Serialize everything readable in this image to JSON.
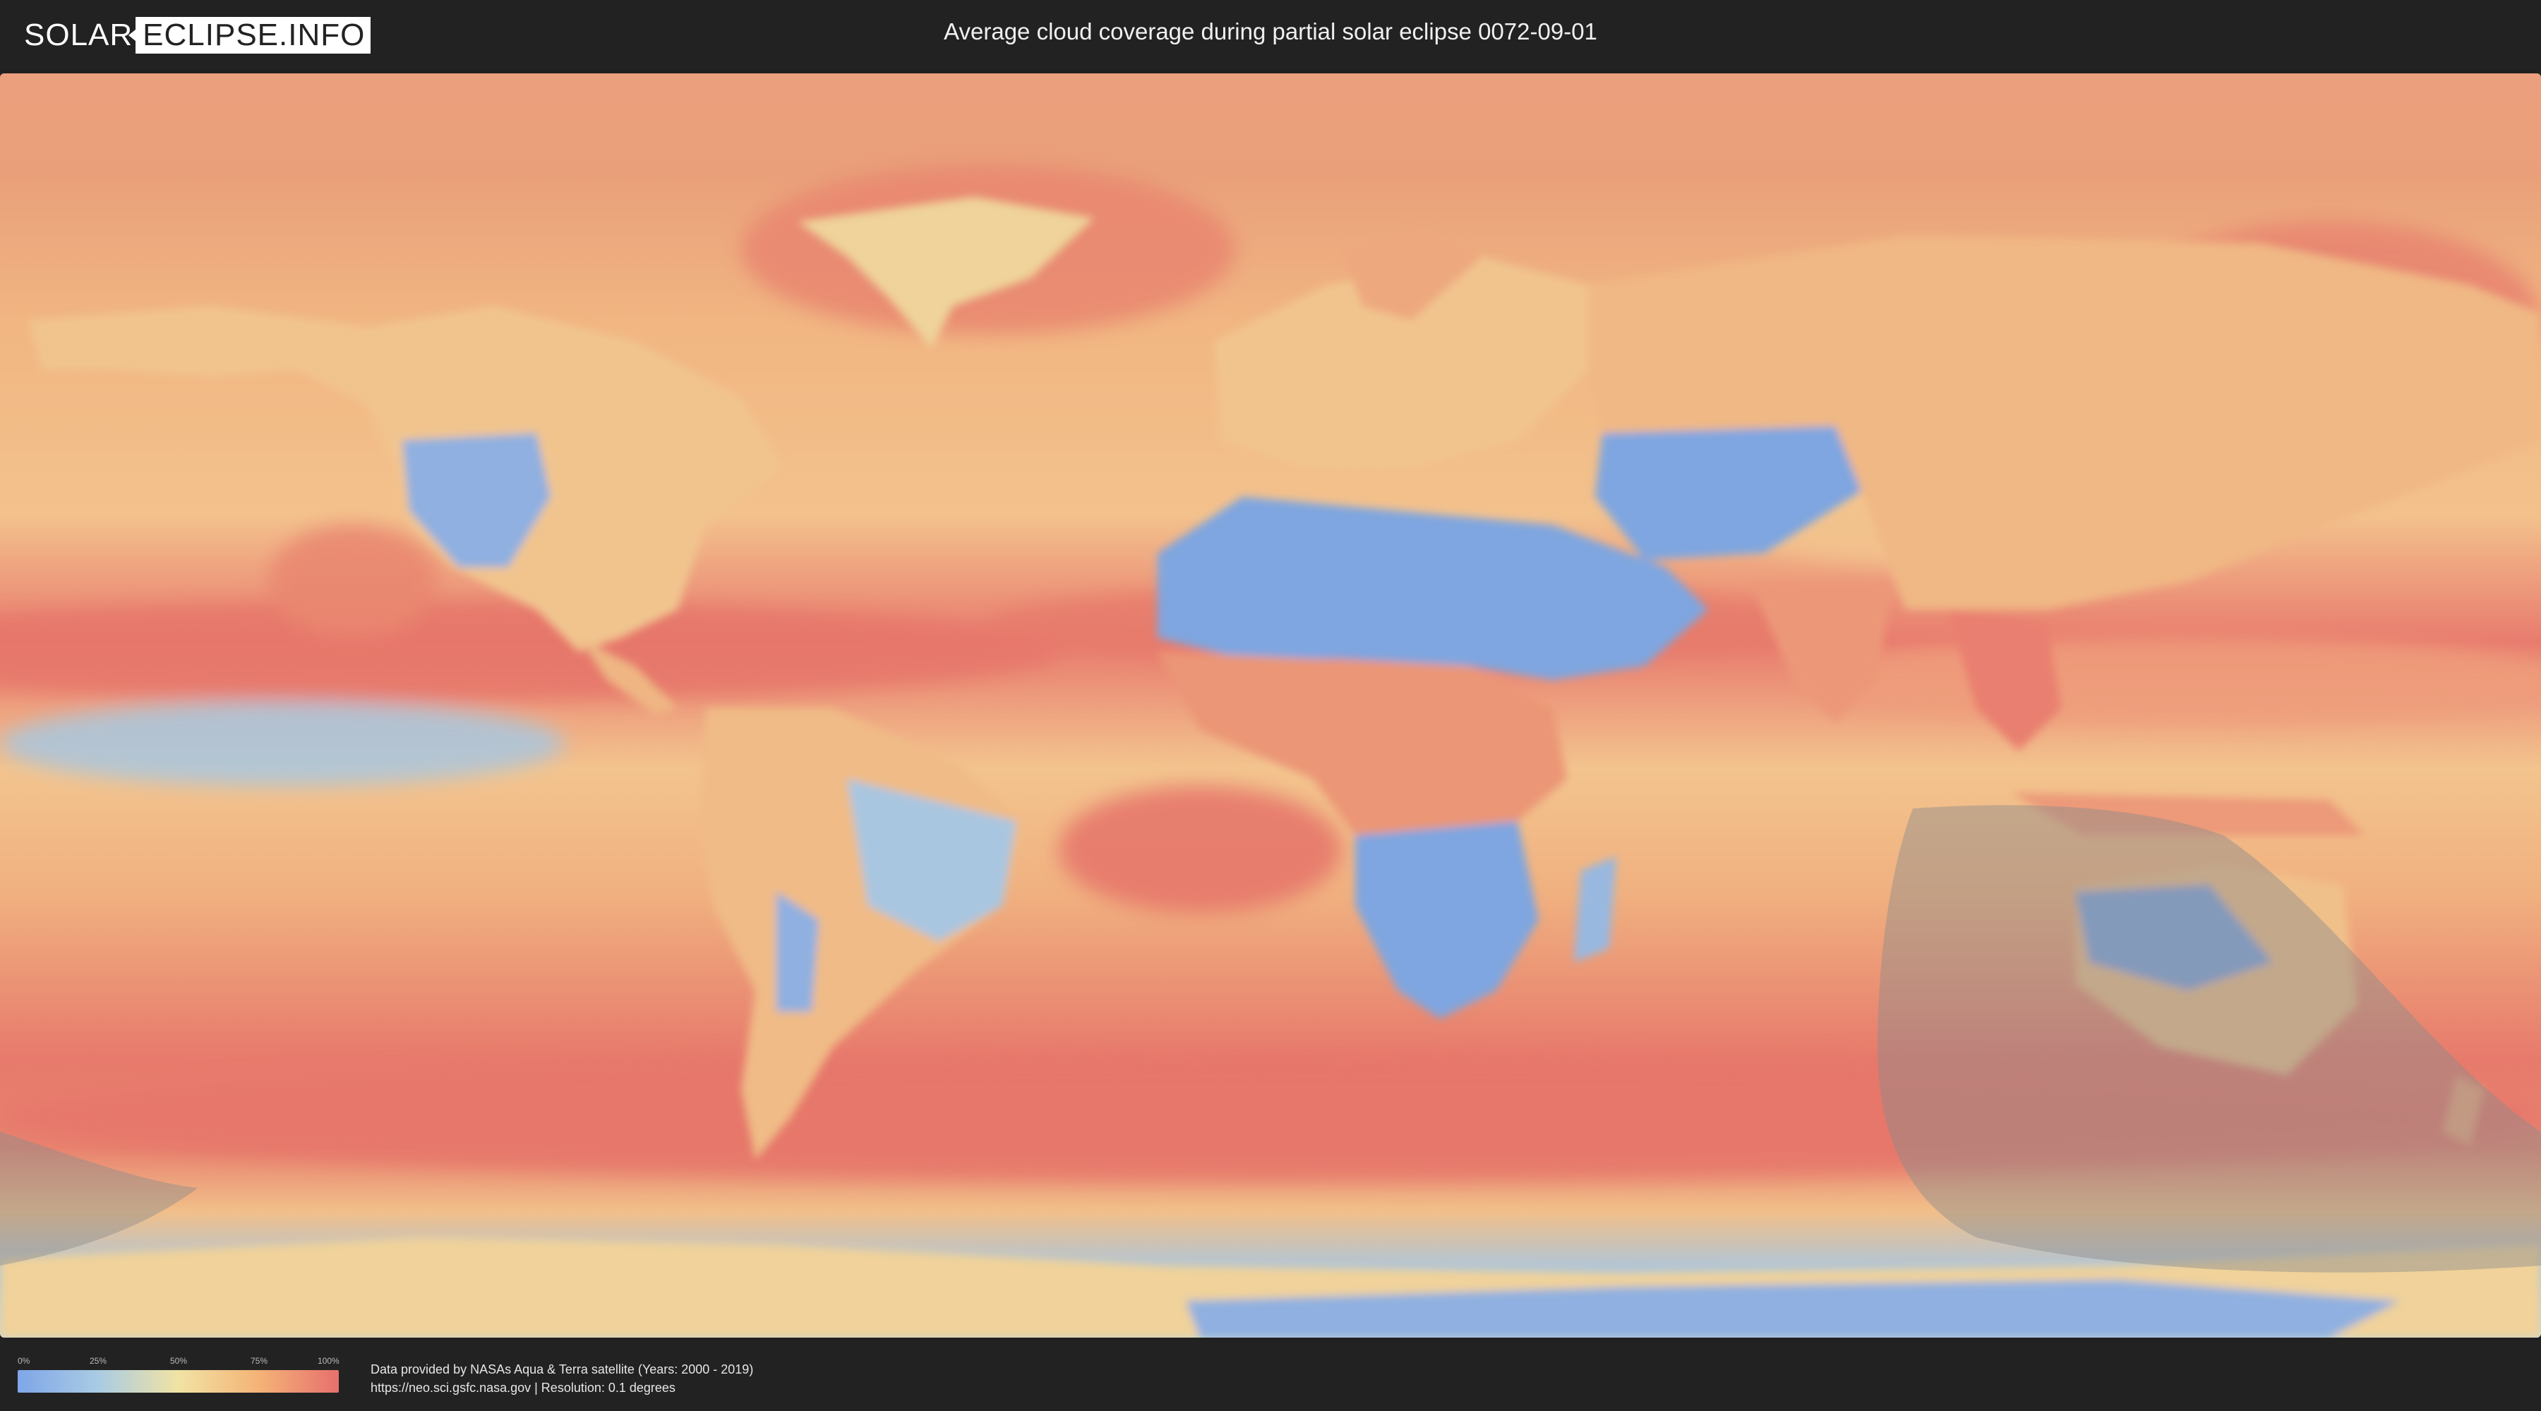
{
  "header": {
    "logo_left": "SOLAR",
    "logo_right": "ECLIPSE.INFO",
    "title": "Average cloud coverage during partial solar eclipse 0072-09-01"
  },
  "map": {
    "ocean_color": "#e27f6e",
    "clear_sky_color": "#7fa6e0",
    "eclipse_overlay_color": "#8c8c8c"
  },
  "legend": {
    "ticks": [
      "0%",
      "25%",
      "50%",
      "75%",
      "100%"
    ],
    "colors": [
      "#7fa6e8",
      "#a9cbe3",
      "#f1e3a4",
      "#f4b377",
      "#e7706e"
    ]
  },
  "footer": {
    "credit_line1": "Data provided by NASAs Aqua & Terra satellite (Years: 2000 - 2019)",
    "credit_line2": "https://neo.sci.gsfc.nasa.gov | Resolution: 0.1 degrees"
  }
}
